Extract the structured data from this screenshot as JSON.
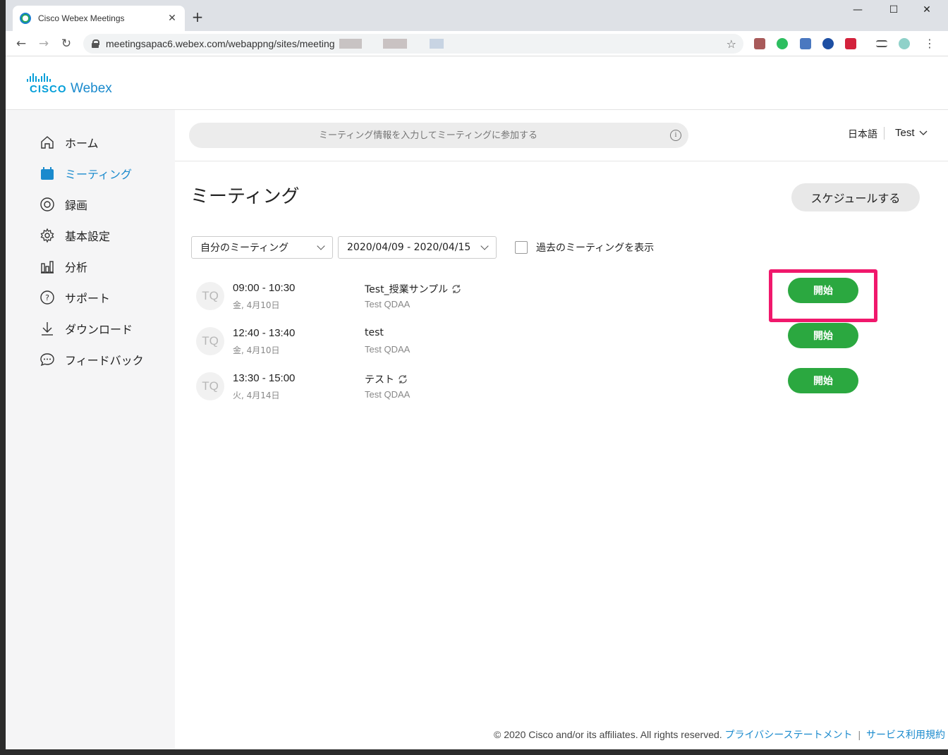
{
  "browser": {
    "tab_title": "Cisco Webex Meetings",
    "tab_close": "✕",
    "new_tab": "+",
    "url": "meetingsapac6.webex.com/webappng/sites/meeting",
    "window_minimize": "—",
    "window_maximize": "☐",
    "window_close": "✕"
  },
  "brand": {
    "cisco": "CISCO",
    "webex": "Webex",
    "accent_color": "#049fd9"
  },
  "sidebar": {
    "items": [
      {
        "label": "ホーム",
        "icon": "home-icon"
      },
      {
        "label": "ミーティング",
        "icon": "calendar-icon",
        "active": true
      },
      {
        "label": "録画",
        "icon": "record-icon"
      },
      {
        "label": "基本設定",
        "icon": "gear-icon"
      },
      {
        "label": "分析",
        "icon": "chart-icon"
      },
      {
        "label": "サポート",
        "icon": "help-icon"
      },
      {
        "label": "ダウンロード",
        "icon": "download-icon"
      },
      {
        "label": "フィードバック",
        "icon": "feedback-icon"
      }
    ]
  },
  "header": {
    "join_placeholder": "ミーティング情報を入力してミーティングに参加する",
    "language": "日本語",
    "user": "Test"
  },
  "main": {
    "title": "ミーティング",
    "schedule_button": "スケジュールする",
    "filter_select": "自分のミーティング",
    "date_range": "2020/04/09 - 2020/04/15",
    "show_past_label": "過去のミーティングを表示",
    "meetings": [
      {
        "avatar": "TQ",
        "time": "09:00 - 10:30",
        "date": "金, 4月10日",
        "title": "Test_授業サンプル",
        "recurring": true,
        "host": "Test QDAA",
        "start_label": "開始"
      },
      {
        "avatar": "TQ",
        "time": "12:40 - 13:40",
        "date": "金, 4月10日",
        "title": "test",
        "recurring": false,
        "host": "Test QDAA",
        "start_label": "開始"
      },
      {
        "avatar": "TQ",
        "time": "13:30 - 15:00",
        "date": "火, 4月14日",
        "title": "テスト",
        "recurring": true,
        "host": "Test QDAA",
        "start_label": "開始"
      }
    ],
    "start_button_color": "#2ba840",
    "highlight_color": "#f0186c"
  },
  "footer": {
    "copyright": "© 2020 Cisco and/or its affiliates. All rights reserved.",
    "privacy": "プライバシーステートメント",
    "separator": "|",
    "terms": "サービス利用規約"
  }
}
